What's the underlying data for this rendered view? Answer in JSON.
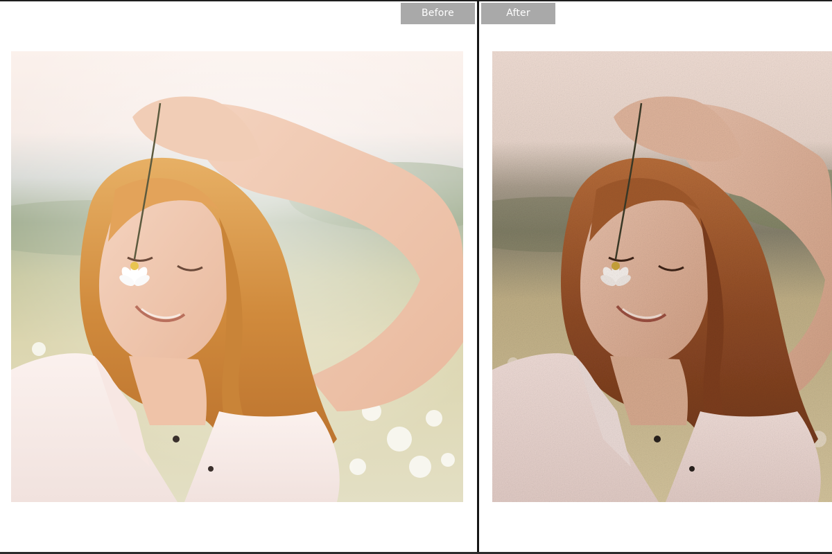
{
  "comparison": {
    "before_label": "Before",
    "after_label": "After"
  },
  "colors": {
    "label_bg": "#a9a9a9",
    "label_text": "#ffffff",
    "divider": "#161616"
  },
  "icons": {
    "before_photo": "portrait-photo-original",
    "after_photo": "portrait-photo-filtered-grain"
  }
}
